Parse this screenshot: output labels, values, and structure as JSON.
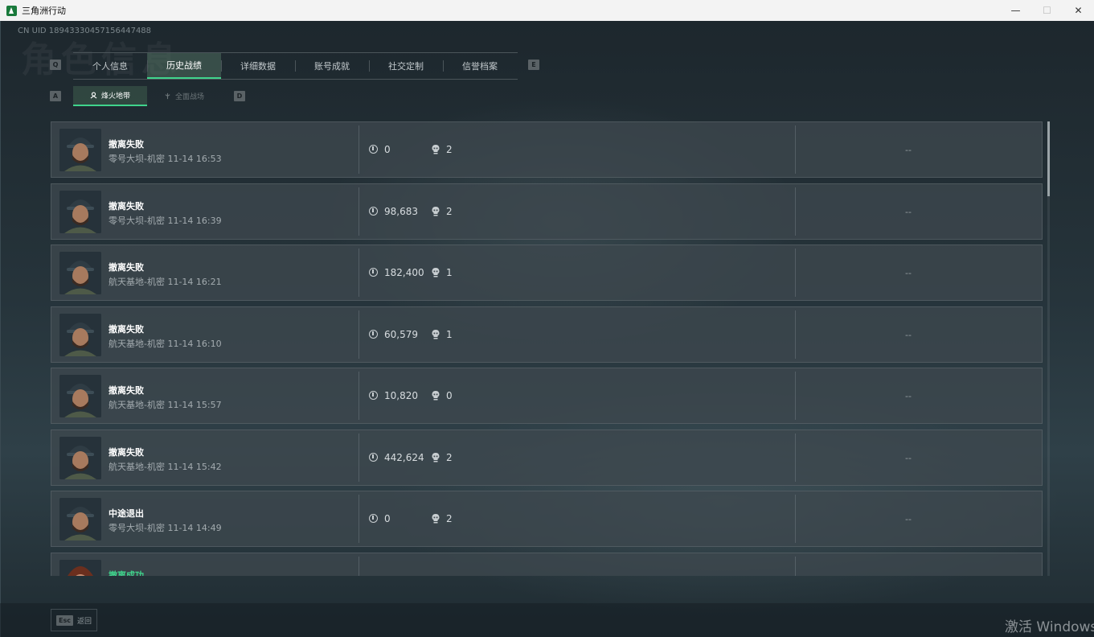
{
  "window": {
    "title": "三角洲行动",
    "minimize": "—",
    "maximize": "☐",
    "close": "✕"
  },
  "header": {
    "uid": "CN UID 18943330457156447488",
    "bg_word": "角色信息"
  },
  "tabs": {
    "left_key": "Q",
    "right_key": "E",
    "items": [
      {
        "label": "个人信息"
      },
      {
        "label": "历史战绩",
        "active": true
      },
      {
        "label": "详细数据"
      },
      {
        "label": "账号成就"
      },
      {
        "label": "社交定制"
      },
      {
        "label": "信誉档案"
      }
    ]
  },
  "subtabs": {
    "left_key": "A",
    "right_key": "D",
    "items": [
      {
        "label": "烽火地带",
        "active": true
      },
      {
        "label": "全面战场"
      }
    ]
  },
  "matches": [
    {
      "status": "撤离失败",
      "success": false,
      "map": "零号大坝-机密 11-14 16:53",
      "value": "0",
      "kills": "2",
      "extra": "--"
    },
    {
      "status": "撤离失败",
      "success": false,
      "map": "零号大坝-机密 11-14 16:39",
      "value": "98,683",
      "kills": "2",
      "extra": "--"
    },
    {
      "status": "撤离失败",
      "success": false,
      "map": "航天基地-机密 11-14 16:21",
      "value": "182,400",
      "kills": "1",
      "extra": "--"
    },
    {
      "status": "撤离失败",
      "success": false,
      "map": "航天基地-机密 11-14 16:10",
      "value": "60,579",
      "kills": "1",
      "extra": "--"
    },
    {
      "status": "撤离失败",
      "success": false,
      "map": "航天基地-机密 11-14 15:57",
      "value": "10,820",
      "kills": "0",
      "extra": "--"
    },
    {
      "status": "撤离失败",
      "success": false,
      "map": "航天基地-机密 11-14 15:42",
      "value": "442,624",
      "kills": "2",
      "extra": "--"
    },
    {
      "status": "中途退出",
      "success": false,
      "map": "零号大坝-机密 11-14 14:49",
      "value": "0",
      "kills": "2",
      "extra": "--"
    },
    {
      "status": "撤离成功",
      "success": true,
      "map": "",
      "value": "",
      "kills": "",
      "extra": ""
    }
  ],
  "footer": {
    "esc_key": "Esc",
    "esc_label": "返回"
  },
  "watermark": "激活 Windows",
  "colors": {
    "accent": "#3fd48c",
    "row_bg": "#3e484e"
  }
}
